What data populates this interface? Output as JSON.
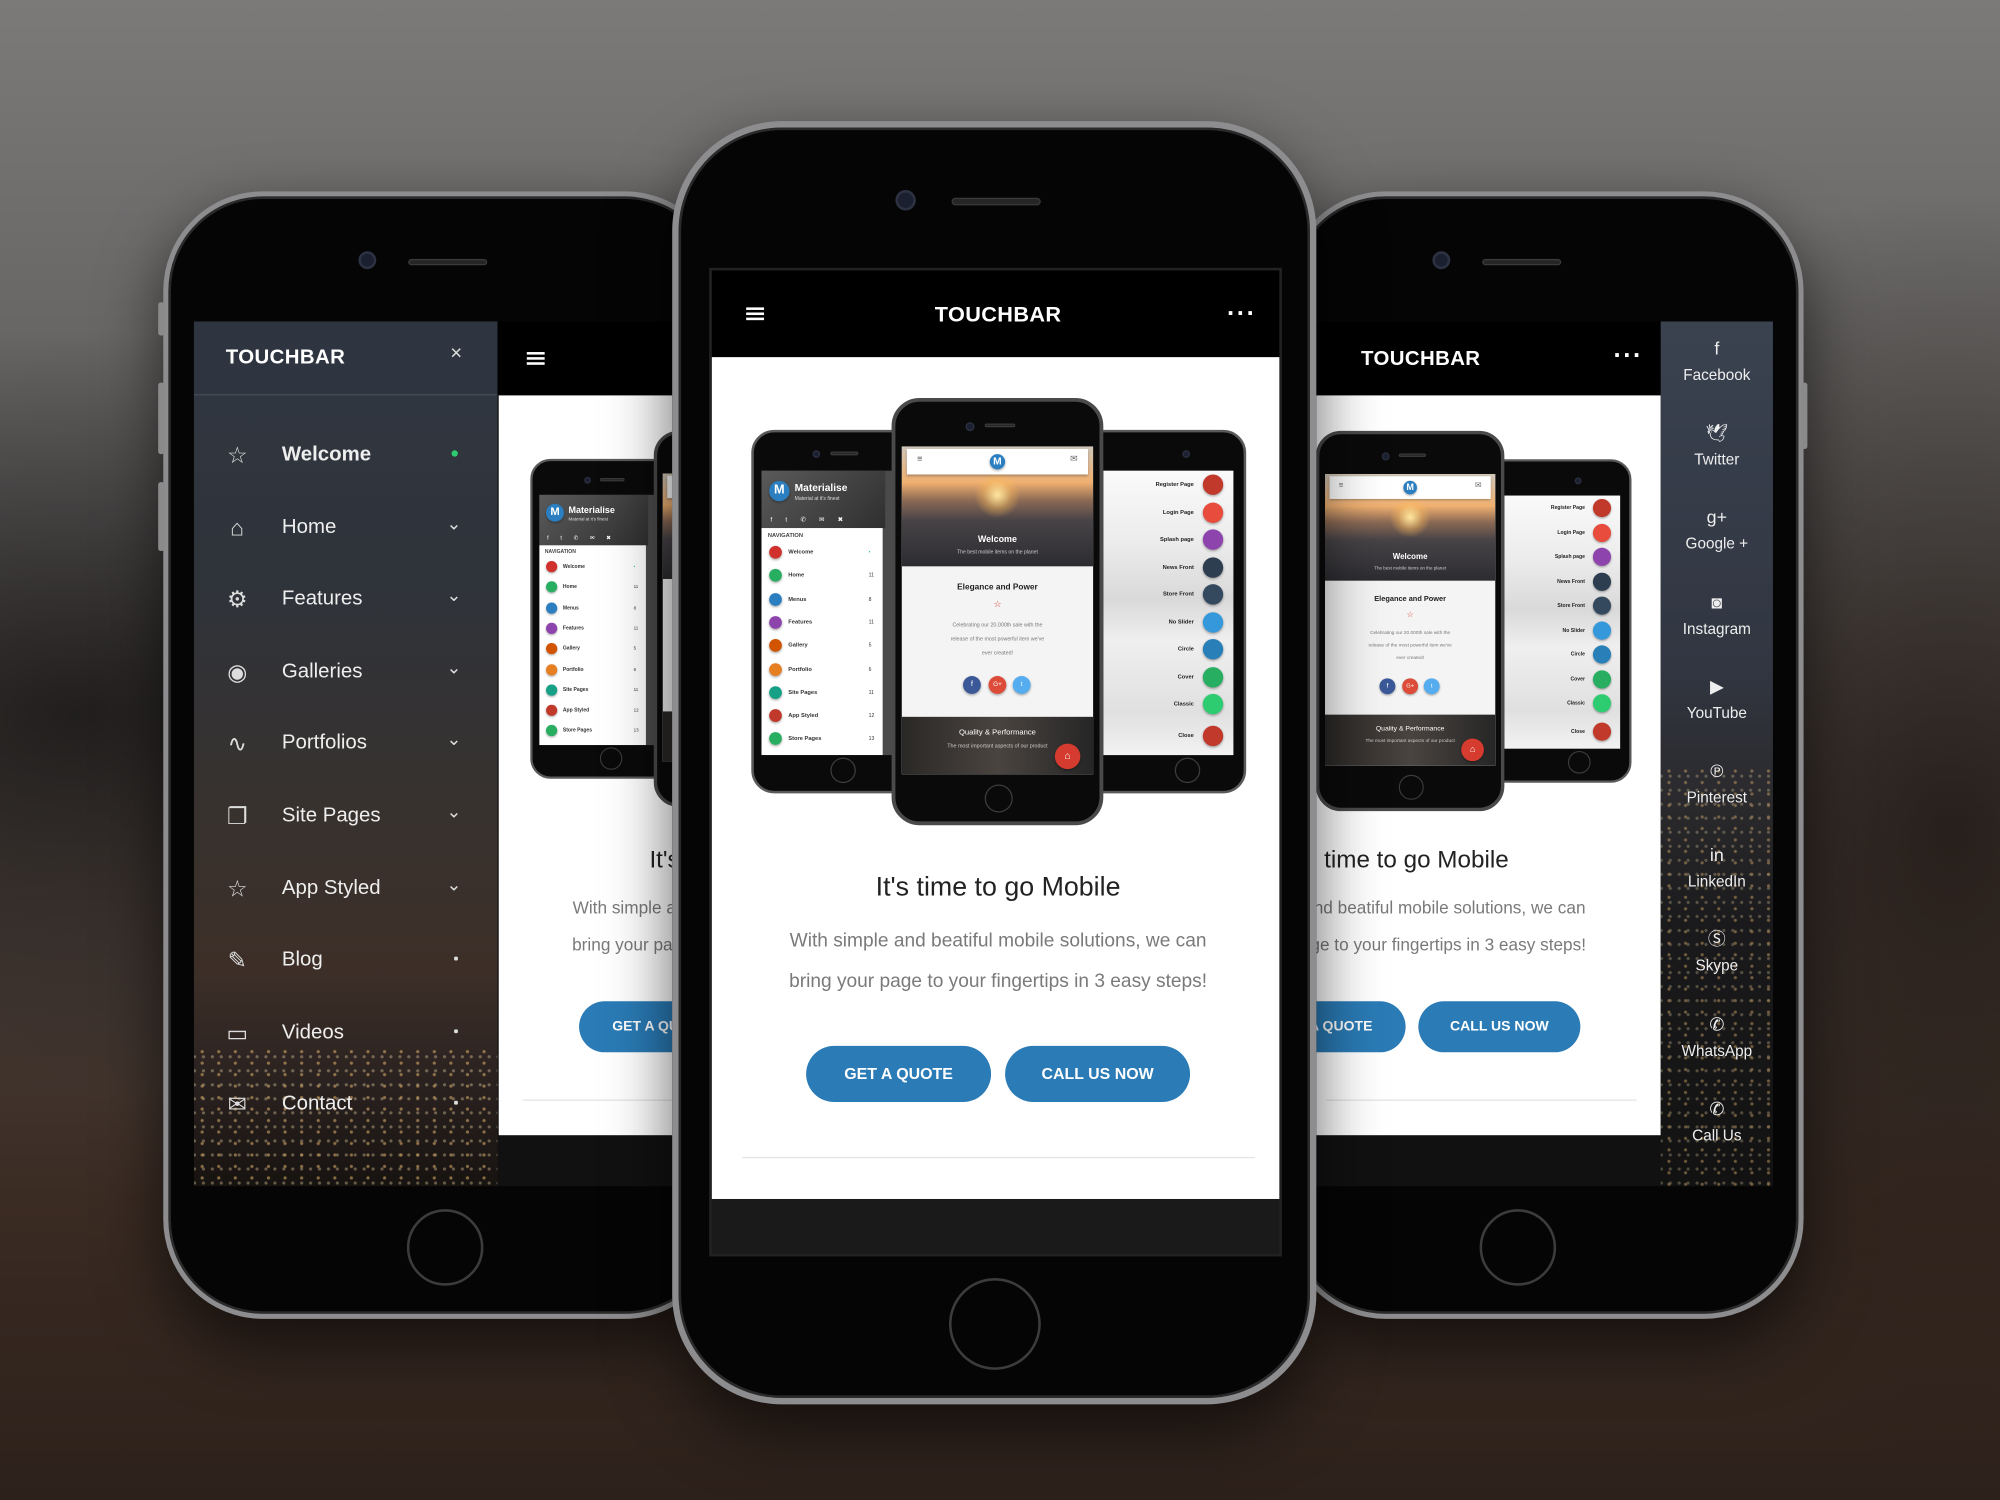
{
  "brand": "TOUCHBAR",
  "colors": {
    "accent": "#2a7bb6",
    "active_dot": "#2ecc71",
    "fab": "#d63b2f"
  },
  "sidebar": {
    "close_icon": "×",
    "items": [
      {
        "label": "Welcome",
        "icon": "star-icon",
        "marker": "dot-active"
      },
      {
        "label": "Home",
        "icon": "home-icon",
        "marker": "chevron"
      },
      {
        "label": "Features",
        "icon": "gear-icon",
        "marker": "chevron"
      },
      {
        "label": "Galleries",
        "icon": "camera-icon",
        "marker": "chevron"
      },
      {
        "label": "Portfolios",
        "icon": "wave-icon",
        "marker": "chevron"
      },
      {
        "label": "Site Pages",
        "icon": "pages-icon",
        "marker": "chevron"
      },
      {
        "label": "App Styled",
        "icon": "star-icon",
        "marker": "chevron"
      },
      {
        "label": "Blog",
        "icon": "edit-icon",
        "marker": "dot"
      },
      {
        "label": "Videos",
        "icon": "video-icon",
        "marker": "dot"
      },
      {
        "label": "Contact",
        "icon": "mail-icon",
        "marker": "dot"
      }
    ]
  },
  "social": {
    "items": [
      {
        "label": "Facebook",
        "icon": "facebook-icon",
        "glyph": "f"
      },
      {
        "label": "Twitter",
        "icon": "twitter-icon",
        "glyph": "🕊"
      },
      {
        "label": "Google +",
        "icon": "google-plus-icon",
        "glyph": "g+"
      },
      {
        "label": "Instagram",
        "icon": "instagram-icon",
        "glyph": "◙"
      },
      {
        "label": "YouTube",
        "icon": "youtube-icon",
        "glyph": "▶"
      },
      {
        "label": "Pinterest",
        "icon": "pinterest-icon",
        "glyph": "℗"
      },
      {
        "label": "LinkedIn",
        "icon": "linkedin-icon",
        "glyph": "in"
      },
      {
        "label": "Skype",
        "icon": "skype-icon",
        "glyph": "Ⓢ"
      },
      {
        "label": "WhatsApp",
        "icon": "whatsapp-icon",
        "glyph": "✆"
      },
      {
        "label": "Call Us",
        "icon": "phone-icon",
        "glyph": "✆"
      }
    ]
  },
  "content": {
    "title": "It's time to go Mobile",
    "para1": "With simple and beatiful mobile solutions, we can",
    "para2": "bring your page to your fingertips in 3 easy steps!",
    "quote_button": "GET A QUOTE",
    "call_button": "CALL US NOW"
  },
  "mockup": {
    "left": {
      "title": "Materialise",
      "subtitle": "Material at it's finest",
      "nav_label": "NAVIGATION",
      "items": [
        {
          "label": "Welcome",
          "count": "•",
          "color": "#d0312d"
        },
        {
          "label": "Home",
          "count": "11",
          "color": "#27ae60"
        },
        {
          "label": "Menus",
          "count": "8",
          "color": "#2b7fc1"
        },
        {
          "label": "Features",
          "count": "11",
          "color": "#8e44ad"
        },
        {
          "label": "Gallery",
          "count": "5",
          "color": "#d35400"
        },
        {
          "label": "Portfolio",
          "count": "6",
          "color": "#e67e22"
        },
        {
          "label": "Site Pages",
          "count": "11",
          "color": "#16a085"
        },
        {
          "label": "App Styled",
          "count": "12",
          "color": "#c0392b"
        },
        {
          "label": "Store Pages",
          "count": "13",
          "color": "#27ae60"
        }
      ]
    },
    "front": {
      "welcome": "Welcome",
      "welcome_sub": "The best mobile items on the planet",
      "card_title": "Elegance and Power",
      "card_lines": [
        "Celebrating our 20.000th sale with the",
        "release of the most powerful item we've",
        "ever created!"
      ],
      "social_colors": [
        "#3b5998",
        "#dd4b39",
        "#55acee"
      ],
      "footer_title": "Quality & Performance",
      "footer_sub": "The most important aspects of our product"
    },
    "right": {
      "items": [
        {
          "label": "Register Page",
          "color": "#c0392b"
        },
        {
          "label": "Login Page",
          "color": "#e74c3c"
        },
        {
          "label": "Splash page",
          "color": "#8e44ad"
        },
        {
          "label": "News Front",
          "color": "#2c3e50"
        },
        {
          "label": "Store Front",
          "color": "#34495e"
        },
        {
          "label": "No Slider",
          "color": "#3498db"
        },
        {
          "label": "Circle",
          "color": "#2980b9"
        },
        {
          "label": "Cover",
          "color": "#27ae60"
        },
        {
          "label": "Classic",
          "color": "#2ecc71"
        },
        {
          "label": "Close",
          "color": "#c0392b"
        }
      ]
    }
  }
}
